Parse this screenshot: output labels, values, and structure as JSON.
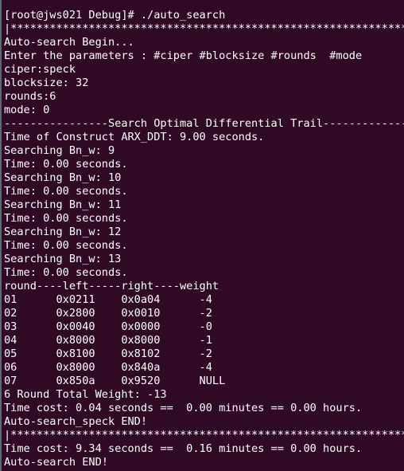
{
  "terminal": {
    "background": "#300a24",
    "foreground": "#ffffff",
    "lines": [
      "[root@jws021 Debug]# ./auto_search",
      "|****************************************************************",
      "Auto-search Begin...",
      "Enter the parameters : #ciper #blocksize #rounds  #mode",
      "ciper:speck",
      "blocksize: 32",
      "rounds:6",
      "mode: 0",
      "----------------Search Optimal Differential Trail--------------",
      "Time of Construct ARX_DDT: 9.00 seconds.",
      "Searching Bn_w: 9",
      "Time: 0.00 seconds.",
      "Searching Bn_w: 10",
      "Time: 0.00 seconds.",
      "Searching Bn_w: 11",
      "Time: 0.00 seconds.",
      "Searching Bn_w: 12",
      "Time: 0.00 seconds.",
      "Searching Bn_w: 13",
      "Time: 0.00 seconds.",
      "round----left-----right----weight",
      "01      0x0211    0x0a04      -4",
      "02      0x2800    0x0010      -2",
      "03      0x0040    0x0000      -0",
      "04      0x8000    0x8000      -1",
      "05      0x8100    0x8102      -2",
      "06      0x8000    0x840a      -4",
      "07      0x850a    0x9520      NULL",
      "6 Round Total Weight: -13",
      "Time cost: 0.04 seconds ==  0.00 minutes == 0.00 hours.",
      "Auto-search_speck END!",
      "|****************************************************************",
      "Time cost: 9.34 seconds ==  0.16 minutes == 0.00 hours.",
      "Auto-search END!"
    ]
  }
}
